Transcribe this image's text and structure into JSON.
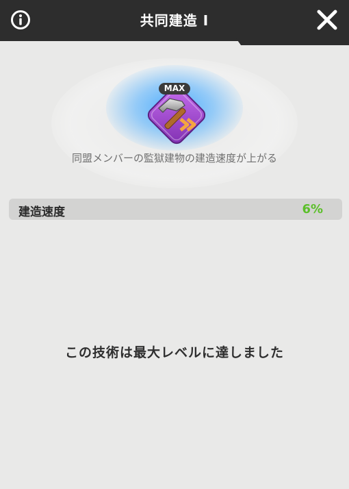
{
  "header": {
    "title": "共同建造 I",
    "info_icon": "info-icon",
    "close_icon": "close-icon"
  },
  "skill": {
    "icon": "hammer-build-speed-icon",
    "badge": "MAX",
    "description": "同盟メンバーの監獄建物の建造速度が上がる"
  },
  "stats": [
    {
      "label": "建造速度",
      "value": "6%"
    }
  ],
  "message": "この技術は最大レベルに達しました",
  "colors": {
    "header_bg": "#2d2d2d",
    "panel_bg": "#e9e9e8",
    "stat_value": "#5bbf2a",
    "icon_purple": "#a24fd0"
  }
}
